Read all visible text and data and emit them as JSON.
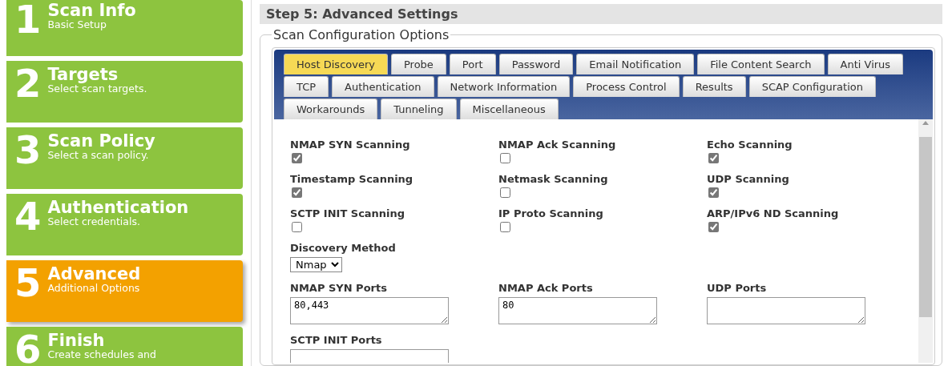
{
  "steps": [
    {
      "number": "1",
      "title": "Scan Info",
      "subtitle": "Basic Setup",
      "selected": false
    },
    {
      "number": "2",
      "title": "Targets",
      "subtitle": "Select scan targets.",
      "selected": false
    },
    {
      "number": "3",
      "title": "Scan Policy",
      "subtitle": "Select a scan policy.",
      "selected": false
    },
    {
      "number": "4",
      "title": "Authentication",
      "subtitle": "Select credentials.",
      "selected": false
    },
    {
      "number": "5",
      "title": "Advanced",
      "subtitle": "Additional Options",
      "selected": true
    },
    {
      "number": "6",
      "title": "Finish",
      "subtitle": "Create schedules and",
      "selected": false
    }
  ],
  "heading": "Step 5: Advanced Settings",
  "fieldset_legend": "Scan Configuration Options",
  "tab_rows": [
    [
      {
        "label": "Host Discovery",
        "selected": true
      },
      {
        "label": "Probe",
        "selected": false
      },
      {
        "label": "Port",
        "selected": false
      },
      {
        "label": "Password",
        "selected": false
      },
      {
        "label": "Email Notification",
        "selected": false
      },
      {
        "label": "File Content Search",
        "selected": false
      },
      {
        "label": "Anti Virus",
        "selected": false
      }
    ],
    [
      {
        "label": "TCP",
        "selected": false
      },
      {
        "label": "Authentication",
        "selected": false
      },
      {
        "label": "Network Information",
        "selected": false
      },
      {
        "label": "Process Control",
        "selected": false
      },
      {
        "label": "Results",
        "selected": false
      },
      {
        "label": "SCAP Configuration",
        "selected": false
      }
    ],
    [
      {
        "label": "Workarounds",
        "selected": false
      },
      {
        "label": "Tunneling",
        "selected": false
      },
      {
        "label": "Miscellaneous",
        "selected": false
      }
    ]
  ],
  "options": [
    {
      "label": "NMAP SYN Scanning",
      "checked": true
    },
    {
      "label": "NMAP Ack Scanning",
      "checked": false
    },
    {
      "label": "Echo Scanning",
      "checked": true
    },
    {
      "label": "Timestamp Scanning",
      "checked": true
    },
    {
      "label": "Netmask Scanning",
      "checked": false
    },
    {
      "label": "UDP Scanning",
      "checked": true
    },
    {
      "label": "SCTP INIT Scanning",
      "checked": false
    },
    {
      "label": "IP Proto Scanning",
      "checked": false
    },
    {
      "label": "ARP/IPv6 ND Scanning",
      "checked": true
    }
  ],
  "discovery_method": {
    "label": "Discovery Method",
    "value": "Nmap"
  },
  "ports": [
    {
      "label": "NMAP SYN Ports",
      "value": "80,443"
    },
    {
      "label": "NMAP Ack Ports",
      "value": "80"
    },
    {
      "label": "UDP Ports"
    },
    {
      "label": "SCTP INIT Ports"
    }
  ]
}
